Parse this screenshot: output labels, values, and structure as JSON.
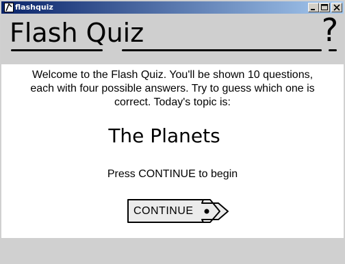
{
  "window": {
    "title": "flashquiz",
    "controls": {
      "minimize": "minimize-icon",
      "maximize": "maximize-icon",
      "close": "close-icon"
    }
  },
  "header": {
    "title": "Flash Quiz",
    "help_label": "?"
  },
  "content": {
    "intro": "Welcome to the Flash Quiz. You'll be shown 10 questions, each with four possible answers. Try to guess which one is correct. Today's topic is:",
    "topic": "The Planets",
    "prompt": "Press CONTINUE to begin",
    "continue_label": "CONTINUE"
  },
  "colors": {
    "titlebar_start": "#0a246a",
    "titlebar_end": "#a6caf0",
    "panel_background": "#ffffff",
    "chrome_background": "#d0d0d0"
  }
}
